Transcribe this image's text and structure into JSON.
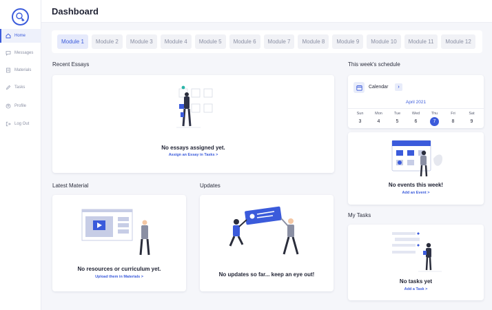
{
  "sidebar": {
    "items": [
      {
        "label": "Home",
        "icon": "home-icon",
        "active": true
      },
      {
        "label": "Messages",
        "icon": "message-icon"
      },
      {
        "label": "Materials",
        "icon": "document-icon"
      },
      {
        "label": "Tasks",
        "icon": "pencil-icon"
      },
      {
        "label": "Profile",
        "icon": "profile-icon"
      },
      {
        "label": "Log Out",
        "icon": "logout-icon"
      }
    ]
  },
  "header": {
    "title": "Dashboard"
  },
  "modules": [
    "Module 1",
    "Module 2",
    "Module 3",
    "Module 4",
    "Module 5",
    "Module 6",
    "Module 7",
    "Module 8",
    "Module 9",
    "Module 10",
    "Module 11",
    "Module 12"
  ],
  "recent_essays": {
    "label": "Recent Essays",
    "empty_title": "No essays assigned yet.",
    "link": "Assign an Essay in Tasks >"
  },
  "latest_material": {
    "label": "Latest Material",
    "empty_title": "No resources or curriculum yet.",
    "link": "Upload them in Materials >"
  },
  "updates": {
    "label": "Updates",
    "empty_title": "No updates so far... keep an eye out!"
  },
  "schedule": {
    "label": "This week's schedule",
    "calendar_label": "Calendar",
    "month": "April 2021",
    "days": [
      {
        "dow": "Sun",
        "num": "3"
      },
      {
        "dow": "Mon",
        "num": "4"
      },
      {
        "dow": "Tue",
        "num": "5"
      },
      {
        "dow": "Wed",
        "num": "6"
      },
      {
        "dow": "Thu",
        "num": "7",
        "today": true
      },
      {
        "dow": "Fri",
        "num": "8"
      },
      {
        "dow": "Sat",
        "num": "9"
      }
    ],
    "events_title": "No events this week!",
    "events_link": "Add an Event >"
  },
  "tasks": {
    "label": "My Tasks",
    "empty_title": "No tasks yet",
    "link": "Add a Task >"
  },
  "colors": {
    "accent": "#3b5bdb",
    "background": "#f5f6fa"
  }
}
